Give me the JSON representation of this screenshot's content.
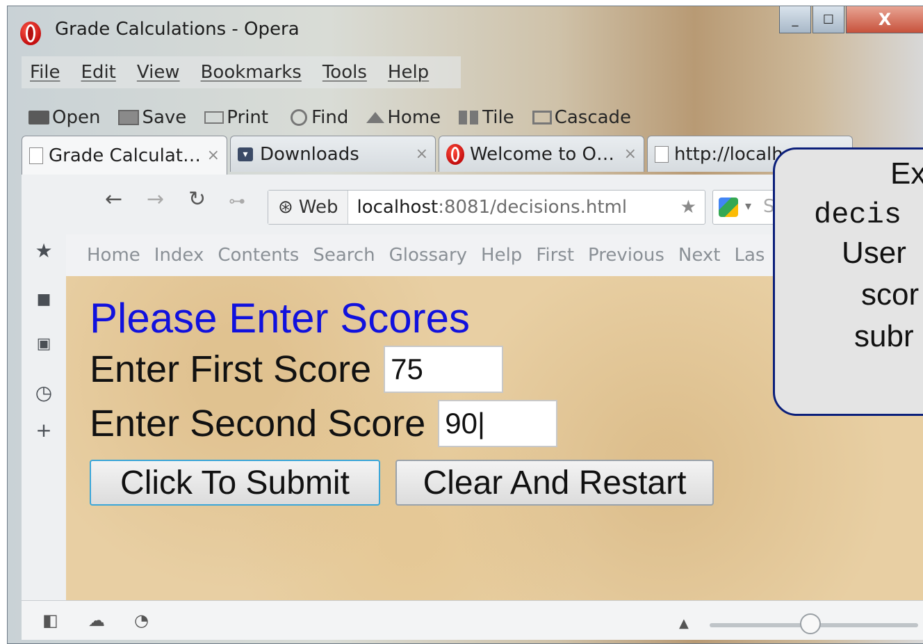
{
  "window": {
    "title": "Grade Calculations - Opera",
    "controls": {
      "minimize": "_",
      "maximize": "☐",
      "close": "X"
    }
  },
  "menubar": {
    "items": [
      "File",
      "Edit",
      "View",
      "Bookmarks",
      "Tools",
      "Help"
    ]
  },
  "toolbar": {
    "items": [
      "Open",
      "Save",
      "Print",
      "Find",
      "Home",
      "Tile",
      "Cascade"
    ]
  },
  "tabs": [
    {
      "label": "Grade Calculat…",
      "close": "×"
    },
    {
      "label": "Downloads",
      "close": "×"
    },
    {
      "label": "Welcome to O…",
      "close": "×"
    },
    {
      "label": "http://localh"
    }
  ],
  "address": {
    "badge": "Web",
    "host": "localhost",
    "path": ":8081/decisions.html",
    "search_initial": "S"
  },
  "navlinks": [
    "Home",
    "Index",
    "Contents",
    "Search",
    "Glossary",
    "Help",
    "First",
    "Previous",
    "Next",
    "Las"
  ],
  "form": {
    "heading": "Please Enter Scores",
    "first_label": "Enter First Score",
    "first_value": "75",
    "second_label": "Enter Second Score",
    "second_value": "90|",
    "submit_label": "Click To Submit",
    "clear_label": "Clear And Restart"
  },
  "callout": {
    "title": "Ex",
    "code": "decis",
    "line1": "User",
    "line2": "scor",
    "line3": "subr"
  }
}
